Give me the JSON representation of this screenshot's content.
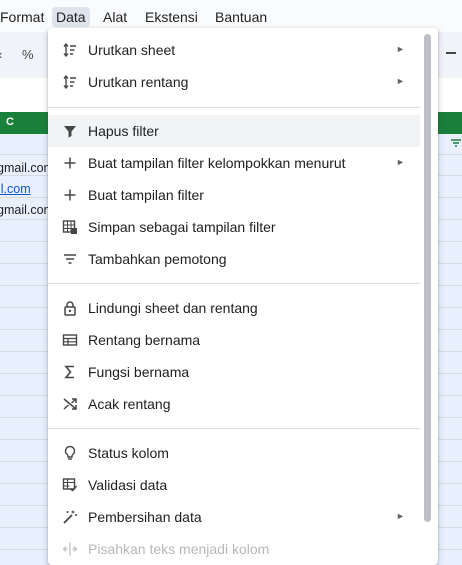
{
  "menubar": {
    "items": [
      "Format",
      "Data",
      "Alat",
      "Ekstensi",
      "Bantuan"
    ],
    "active": "Data"
  },
  "toolbar": {
    "percent": "%"
  },
  "sheet": {
    "column_header": "C",
    "cells": [
      "gmail.com",
      "il.com",
      "gmail.com"
    ],
    "header_color": "#188038",
    "selection_color": "#e8f0fe"
  },
  "menu": {
    "items": [
      {
        "label": "Urutkan sheet",
        "icon": "sort-icon",
        "submenu": true
      },
      {
        "label": "Urutkan rentang",
        "icon": "sort-icon",
        "submenu": true
      },
      {
        "label": "Hapus filter",
        "icon": "filter-icon",
        "submenu": false
      },
      {
        "label": "Buat tampilan filter kelompokkan menurut",
        "icon": "plus-icon",
        "submenu": true
      },
      {
        "label": "Buat tampilan filter",
        "icon": "plus-icon",
        "submenu": false
      },
      {
        "label": "Simpan sebagai tampilan filter",
        "icon": "table-save-icon",
        "submenu": false
      },
      {
        "label": "Tambahkan pemotong",
        "icon": "slicer-icon",
        "submenu": false
      },
      {
        "label": "Lindungi sheet dan rentang",
        "icon": "lock-icon",
        "submenu": false
      },
      {
        "label": "Rentang bernama",
        "icon": "named-range-icon",
        "submenu": false
      },
      {
        "label": "Fungsi bernama",
        "icon": "sigma-icon",
        "submenu": false
      },
      {
        "label": "Acak rentang",
        "icon": "shuffle-icon",
        "submenu": false
      },
      {
        "label": "Status kolom",
        "icon": "lightbulb-icon",
        "submenu": false
      },
      {
        "label": "Validasi data",
        "icon": "data-validation-icon",
        "submenu": false
      },
      {
        "label": "Pembersihan data",
        "icon": "magic-wand-icon",
        "submenu": true
      },
      {
        "label": "Pisahkan teks menjadi kolom",
        "icon": "split-columns-icon",
        "submenu": false,
        "disabled": true
      }
    ],
    "submenu_arrow": "►"
  }
}
